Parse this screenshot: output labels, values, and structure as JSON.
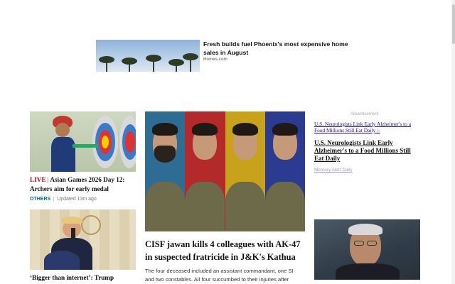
{
  "sponsored_top": {
    "headline": "Fresh builds fuel Phoenix's most expensive home sales in August",
    "source": "Homes.com"
  },
  "left_column": {
    "story1": {
      "live_label": "LIVE",
      "separator": "|",
      "headline": "Asian Games 2026 Day 12: Archers aim for early medal",
      "category": "OTHERS",
      "updated": "Updated 13m ago"
    },
    "story2": {
      "headline": "‘Bigger than internet’: Trump doubles down on quantum AI"
    }
  },
  "lead_story": {
    "title": "CISF jawan kills 4 colleagues with AK-47 in suspected fratricide in J&K's Kathua",
    "summary": "The four deceased included an assistant commandant, one SI and two constables. All four succumbed to their injuries after",
    "panel_colors": [
      "#2d6d93",
      "#b42a2a",
      "#c9a21c",
      "#2b3b8f"
    ]
  },
  "right_column": {
    "advertisement_label": "Advertisement",
    "ad_image_alt": "U.S. Neurologists Link Early Alzheimer's to a Food Millions Still Eat Daily",
    "ad_title": "U.S. Neurologists Link Early Alzheimer's to a Food Millions Still Eat Daily",
    "ad_source": "Memory Alert Daily"
  }
}
